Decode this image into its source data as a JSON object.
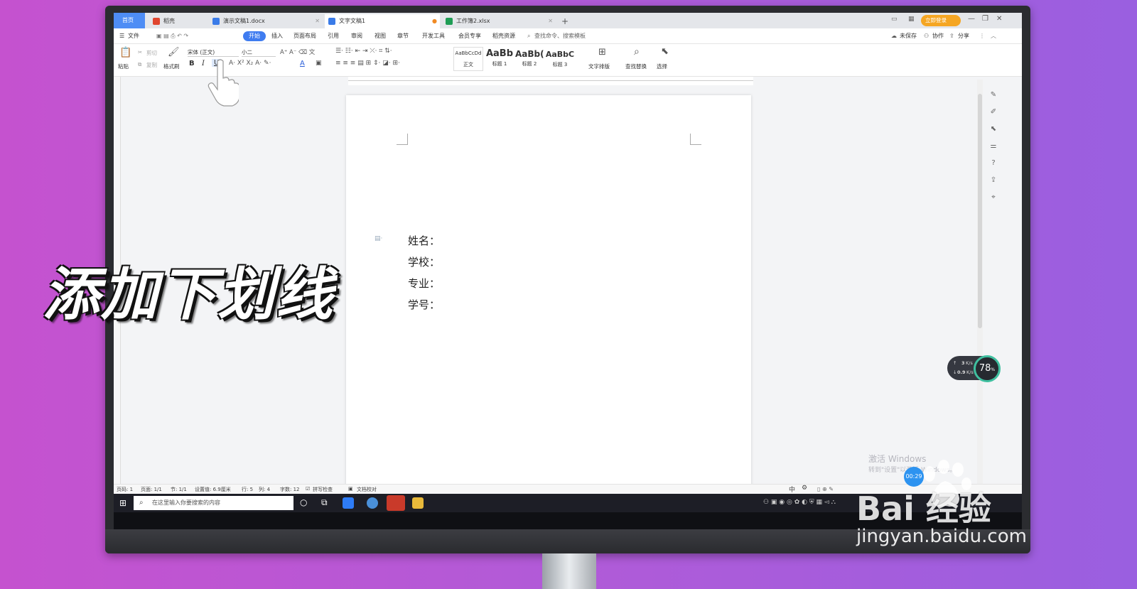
{
  "tabs": [
    {
      "label": "首页"
    },
    {
      "label": "稻壳"
    },
    {
      "label": "演示文稿1.docx"
    },
    {
      "label": "文字文稿1"
    },
    {
      "label": "工作簿2.xlsx"
    }
  ],
  "titlebar": {
    "login_label": "立即登录",
    "new_tab": "+"
  },
  "menubar": {
    "file": "文件",
    "items": [
      "开始",
      "插入",
      "页面布局",
      "引用",
      "审阅",
      "视图",
      "章节",
      "开发工具",
      "会员专享",
      "稻壳资源"
    ],
    "search_placeholder": "查找命令、搜索模板",
    "unsaved": "未保存",
    "collab": "协作",
    "share": "分享"
  },
  "ribbon": {
    "paste": "粘贴",
    "cut": "剪切",
    "copy": "复制",
    "format_painter": "格式刷",
    "font_name": "宋体 (正文)",
    "font_size": "小二",
    "styles": [
      {
        "preview": "AaBbCcDd",
        "label": "正文"
      },
      {
        "preview": "AaBb",
        "label": "标题 1"
      },
      {
        "preview": "AaBb(",
        "label": "标题 2"
      },
      {
        "preview": "AaBbC",
        "label": "标题 3"
      }
    ],
    "text_layout": "文字排版",
    "find_replace": "查找替换",
    "select": "选择"
  },
  "document": {
    "lines": [
      "姓名：",
      "学校：",
      "专业：",
      "学号："
    ]
  },
  "statusbar": {
    "page": "页码: 1",
    "pages": "页面: 1/1",
    "section": "节: 1/1",
    "setting": "设置值: 6.9厘米",
    "row": "行: 5",
    "col": "列: 4",
    "words": "字数: 12",
    "spell": "拼写检查",
    "proof": "文档校对"
  },
  "taskbar": {
    "search_placeholder": "在这里输入你要搜索的内容",
    "ime": "中"
  },
  "overlay": {
    "title": "添加下划线",
    "activate_line1": "激活 Windows",
    "activate_line2": "转到\"设置\"以激活 Windows。",
    "timer": "00:29",
    "speed_up": "3",
    "speed_up_unit": "K/s",
    "speed_down": "0.9",
    "speed_down_unit": "K/s",
    "cpu_percent": "78",
    "cpu_unit": "%",
    "watermark": "Bai 经验",
    "watermark_url": "jingyan.baidu.com"
  },
  "colors": {
    "accent_blue": "#3f7cf0",
    "login_orange": "#f5a623",
    "background_purple": "#c552cf"
  }
}
